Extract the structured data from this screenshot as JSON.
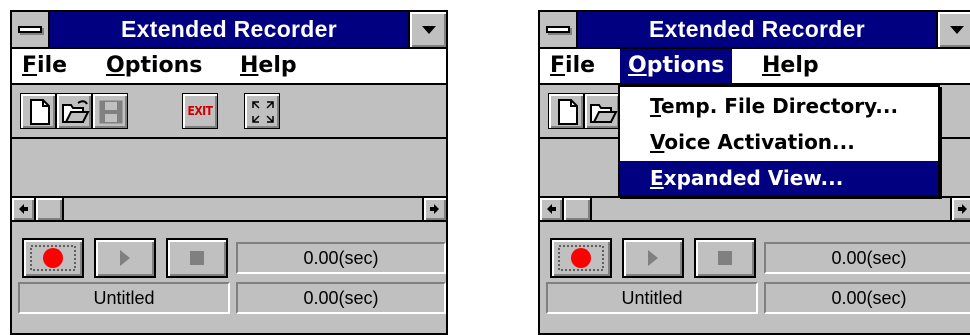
{
  "windows": [
    {
      "id": "left",
      "title": "Extended Recorder",
      "menu": [
        {
          "first": "F",
          "rest": "ile"
        },
        {
          "first": "O",
          "rest": "ptions"
        },
        {
          "first": "H",
          "rest": "elp"
        }
      ],
      "toolbar": {
        "exit_label": "EXIT"
      },
      "status": {
        "time_total": "0.00(sec)",
        "filename": "Untitled",
        "time_position": "0.00(sec)"
      }
    },
    {
      "id": "right",
      "title": "Extended Recorder",
      "menu": [
        {
          "first": "F",
          "rest": "ile"
        },
        {
          "first": "O",
          "rest": "ptions"
        },
        {
          "first": "H",
          "rest": "elp"
        }
      ],
      "active_menu": "Options",
      "options_menu": [
        {
          "first": "T",
          "rest": "emp. File Directory..."
        },
        {
          "first": "V",
          "rest": "oice Activation..."
        },
        {
          "first": "E",
          "rest": "xpanded View..."
        }
      ],
      "selected_item": "Expanded View...",
      "status": {
        "time_total": "0.00(sec)",
        "filename": "Untitled",
        "time_position": "0.00(sec)"
      }
    }
  ],
  "colors": {
    "titlebar": "#000080",
    "record_dot": "#ff0000",
    "exit_text": "#d00000",
    "face": "#c0c0c0"
  },
  "icons": [
    "system-menu-icon",
    "dropdown-arrow-icon",
    "new-file-icon",
    "open-folder-icon",
    "save-disk-icon",
    "exit-icon",
    "expand-view-icon",
    "scroll-left-arrow-icon",
    "scroll-right-arrow-icon",
    "record-icon",
    "play-icon",
    "stop-icon"
  ]
}
